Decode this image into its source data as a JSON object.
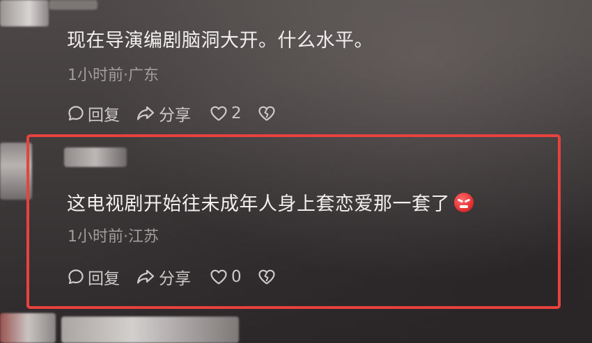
{
  "comments": [
    {
      "text": "现在导演编剧脑洞大开。什么水平。",
      "meta": "1小时前·广东",
      "reply_label": "回复",
      "share_label": "分享",
      "like_count": "2"
    },
    {
      "text": "这电视剧开始往未成年人身上套恋爱那一套了",
      "emoji": "angry-face-emoji",
      "meta": "1小时前·江苏",
      "reply_label": "回复",
      "share_label": "分享",
      "like_count": "0"
    }
  ],
  "colors": {
    "highlight": "#e8423f",
    "text": "#f2f0ef",
    "meta": "#a39d9c",
    "action": "#cfcac9"
  },
  "icons": [
    "reply-bubble-icon",
    "share-arrow-icon",
    "heart-icon",
    "broken-heart-icon"
  ]
}
